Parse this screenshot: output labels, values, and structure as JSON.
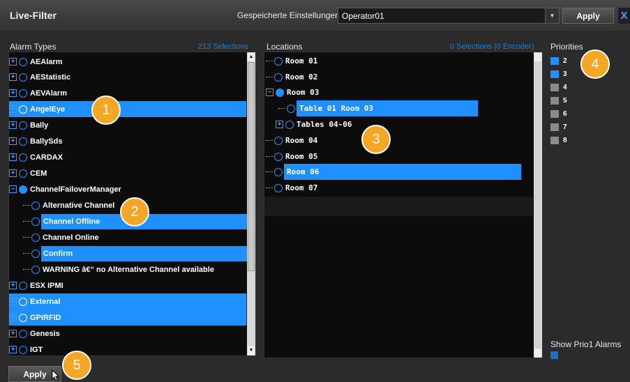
{
  "header": {
    "title": "Live-Filter",
    "saved_settings_label": "Gespeicherte Einstellungen",
    "saved_settings_value": "Operator01",
    "apply_label": "Apply",
    "close_label": "X"
  },
  "alarm_types": {
    "label": "Alarm Types",
    "count": "213 Selections",
    "items": [
      {
        "label": "AEAlarm"
      },
      {
        "label": "AEStatistic"
      },
      {
        "label": "AEVAlarm"
      },
      {
        "label": "AngelEye"
      },
      {
        "label": "Bally"
      },
      {
        "label": "BallySds"
      },
      {
        "label": "CARDAX"
      },
      {
        "label": "CEM"
      },
      {
        "label": "ChannelFailoverManager"
      },
      {
        "label": "Alternative Channel"
      },
      {
        "label": "Channel Offline"
      },
      {
        "label": "Channel Online"
      },
      {
        "label": "Confirm"
      },
      {
        "label": "WARNING â€“ no Alternative Channel available"
      },
      {
        "label": "ESX IPMI"
      },
      {
        "label": "External"
      },
      {
        "label": "GPIRFID"
      },
      {
        "label": "Genesis"
      },
      {
        "label": "IGT"
      }
    ]
  },
  "locations": {
    "label": "Locations",
    "count": "0 Selections (0 Encoder)",
    "items": [
      {
        "label": "Room 01"
      },
      {
        "label": "Room 02"
      },
      {
        "label": "Room 03"
      },
      {
        "label": "Table 01 Room 03"
      },
      {
        "label": "Tables 04-06"
      },
      {
        "label": "Room 04"
      },
      {
        "label": "Room 05"
      },
      {
        "label": "Room 06"
      },
      {
        "label": "Room 07"
      }
    ]
  },
  "priorities": {
    "label": "Priorities",
    "items": [
      {
        "label": "2",
        "checked": true
      },
      {
        "label": "3",
        "checked": true
      },
      {
        "label": "4",
        "checked": false
      },
      {
        "label": "5",
        "checked": false
      },
      {
        "label": "6",
        "checked": false
      },
      {
        "label": "7",
        "checked": false
      },
      {
        "label": "8",
        "checked": false
      }
    ],
    "show_prio1_label": "Show Prio1 Alarms"
  },
  "footer": {
    "apply_label": "Apply"
  },
  "callouts": [
    "1",
    "2",
    "3",
    "4",
    "5"
  ],
  "colors": {
    "accent": "#1e90ff",
    "callout": "#f5a623",
    "count_text": "#1e7ec8"
  }
}
